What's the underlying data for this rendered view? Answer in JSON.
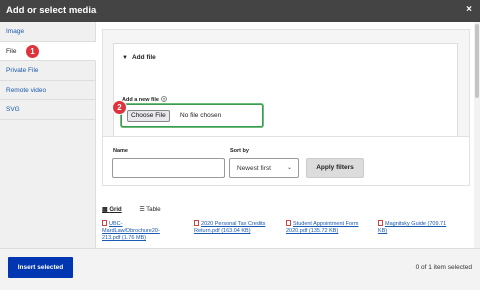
{
  "dialog": {
    "title": "Add or select media",
    "close_icon": "×"
  },
  "sidebar": {
    "items": [
      {
        "label": "Image"
      },
      {
        "label": "File"
      },
      {
        "label": "Private File"
      },
      {
        "label": "Remote video"
      },
      {
        "label": "SVG"
      }
    ],
    "active": "File"
  },
  "badges": {
    "first": "1",
    "second": "2"
  },
  "add_file": {
    "summary": "Add file",
    "new_file_label": "Add a new file",
    "choose_button": "Choose File",
    "no_file_text": "No file chosen"
  },
  "filters": {
    "name_label": "Name",
    "name_value": "",
    "sort_label": "Sort by",
    "sort_value": "Newest first",
    "apply_button": "Apply filters"
  },
  "views": {
    "grid": "Grid",
    "table": "Table"
  },
  "cards": [
    {
      "text": "UBC-\nMardLaw/Dbrochure20-\n213.pdf (1.76 MB)"
    },
    {
      "text": "2020 Personal Tax Credits\nReturn.pdf (163.04 KB)"
    },
    {
      "text": "Student Appointment Form\n2020.pdf (135.72 KB)"
    },
    {
      "text": "Magnitsky Guide (709.71\nKB)"
    }
  ],
  "footer": {
    "insert_button": "Insert selected",
    "selection_count": "0 of 1 item selected"
  },
  "colors": {
    "titlebar": "#444444",
    "accent_blue": "#0036b1",
    "badge_red": "#e0323a",
    "focus_green": "#3d9a4f"
  }
}
